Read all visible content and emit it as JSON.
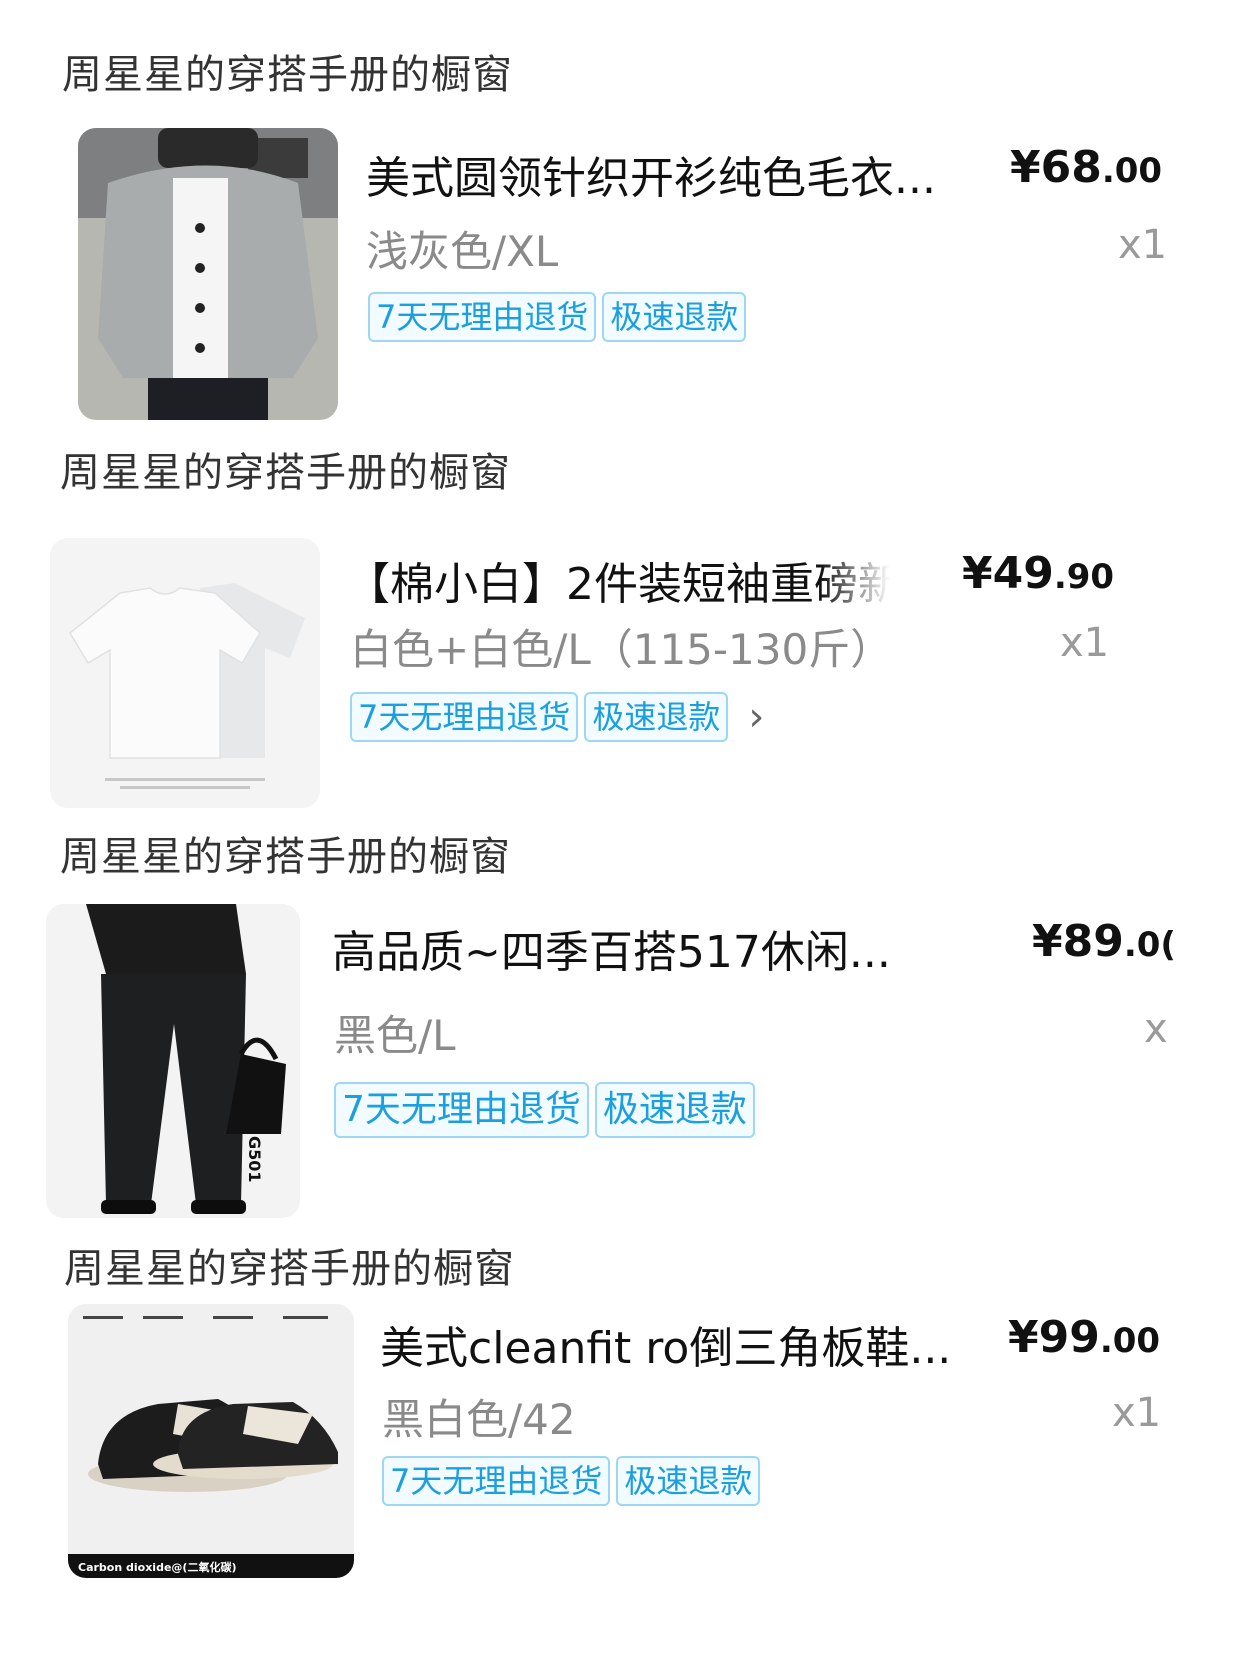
{
  "orders": [
    {
      "shop": "周星星的穿搭手册的橱窗",
      "title": "美式圆领针织开衫纯色毛衣...",
      "spec": "浅灰色/XL",
      "price_int": "¥68",
      "price_dec": ".00",
      "qty": "x1",
      "tags": [
        "7天无理由退货",
        "极速退款"
      ]
    },
    {
      "shop": "周星星的穿搭手册的橱窗",
      "title": "【棉小白】2件装短袖重磅新",
      "spec": "白色+白色/L（115-130斤）",
      "price_int": "¥49",
      "price_dec": ".90",
      "qty": "x1",
      "tags": [
        "7天无理由退货",
        "极速退款"
      ]
    },
    {
      "shop": "周星星的穿搭手册的橱窗",
      "title": "高品质~四季百搭517休闲...",
      "spec": "黑色/L",
      "price_int": "¥89",
      "price_dec": ".0(",
      "qty": "x",
      "tags": [
        "7天无理由退货",
        "极速退款"
      ],
      "image_label": "G501"
    },
    {
      "shop": "周星星的穿搭手册的橱窗",
      "title": "美式cleanfit ro倒三角板鞋...",
      "spec": "黑白色/42",
      "price_int": "¥99",
      "price_dec": ".00",
      "qty": "x1",
      "tags": [
        "7天无理由退货",
        "极速退款"
      ],
      "image_label": "Carbon dioxide@(二氧化碳)"
    }
  ],
  "colors": {
    "tag_text": "#1a9fe0",
    "tag_border": "#9dd7f3",
    "tag_bg": "#f2fbff"
  },
  "icons": {
    "order2_more": "chevron-right-icon"
  }
}
